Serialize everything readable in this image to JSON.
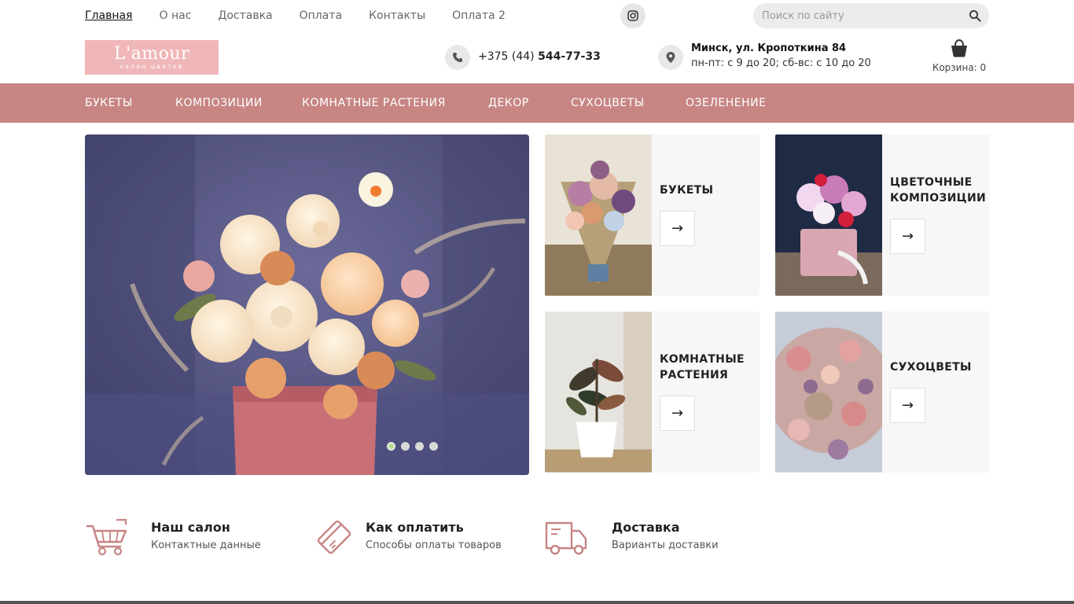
{
  "top_nav": {
    "items": [
      "Главная",
      "О нас",
      "Доставка",
      "Оплата",
      "Контакты",
      "Оплата 2"
    ]
  },
  "search": {
    "placeholder": "Поиск по сайту"
  },
  "logo": {
    "title": "L'amour",
    "subtitle": "салон цветов"
  },
  "contacts": {
    "phone_prefix": "+375 (44) ",
    "phone_number": "544-77-33",
    "address": "Минск, ул. Кропоткина 84",
    "hours": "пн-пт: с 9 до 20; сб-вс: с 10 до 20"
  },
  "cart": {
    "label": "Корзина: 0"
  },
  "categories": [
    "БУКЕТЫ",
    "КОМПОЗИЦИИ",
    "КОМНАТНЫЕ РАСТЕНИЯ",
    "ДЕКОР",
    "СУХОЦВЕТЫ",
    "ОЗЕЛЕНЕНИЕ"
  ],
  "slider": {
    "slides": 4,
    "active": 1
  },
  "cards": [
    {
      "title": "БУКЕТЫ",
      "arrow": "→"
    },
    {
      "title": "ЦВЕТОЧНЫЕ КОМПОЗИЦИИ",
      "arrow": "→"
    },
    {
      "title": "КОМНАТНЫЕ РАСТЕНИЯ",
      "arrow": "→"
    },
    {
      "title": "СУХОЦВЕТЫ",
      "arrow": "→"
    }
  ],
  "features": [
    {
      "title": "Наш салон",
      "subtitle": "Контактные данные",
      "icon": "cart-icon"
    },
    {
      "title": "Как оплатить",
      "subtitle": "Способы оплаты товаров",
      "icon": "credit-card-icon"
    },
    {
      "title": "Доставка",
      "subtitle": "Варианты доставки",
      "icon": "truck-icon"
    }
  ],
  "colors": {
    "accent": "#c78584",
    "logo_bg": "#f0b7b8",
    "card_bg": "#f7f7f7"
  }
}
